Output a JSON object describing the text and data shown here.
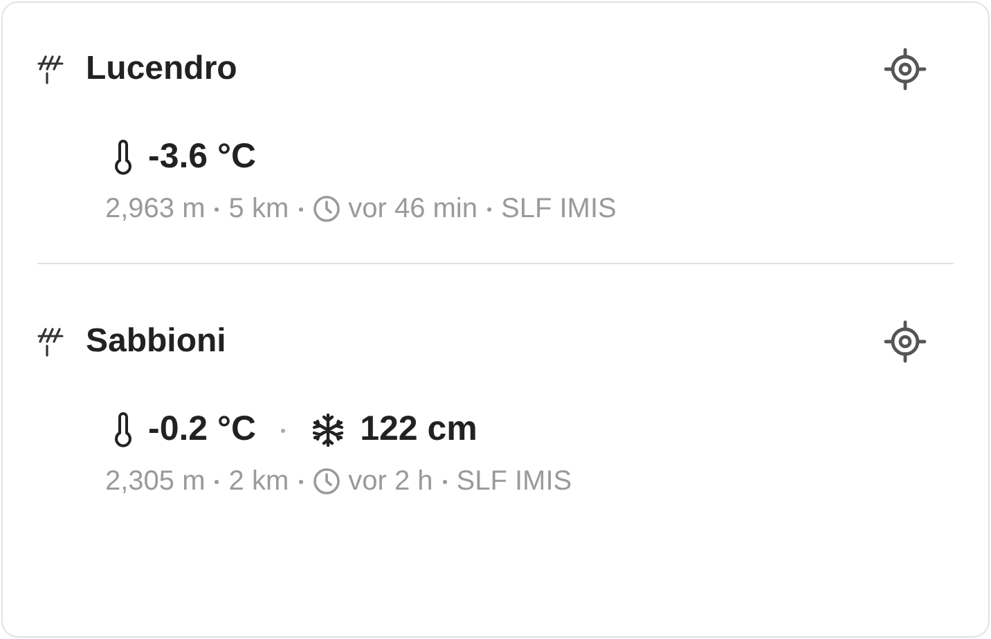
{
  "stations": [
    {
      "name": "Lucendro",
      "readings": [
        {
          "kind": "temperature",
          "value": "-3.6 °C"
        }
      ],
      "elevation": "2,963 m",
      "distance": "5 km",
      "age": "vor 46 min",
      "source": "SLF IMIS"
    },
    {
      "name": "Sabbioni",
      "readings": [
        {
          "kind": "temperature",
          "value": "-0.2 °C"
        },
        {
          "kind": "snow",
          "value": "122 cm"
        }
      ],
      "elevation": "2,305 m",
      "distance": "2 km",
      "age": "vor 2 h",
      "source": "SLF IMIS"
    }
  ]
}
